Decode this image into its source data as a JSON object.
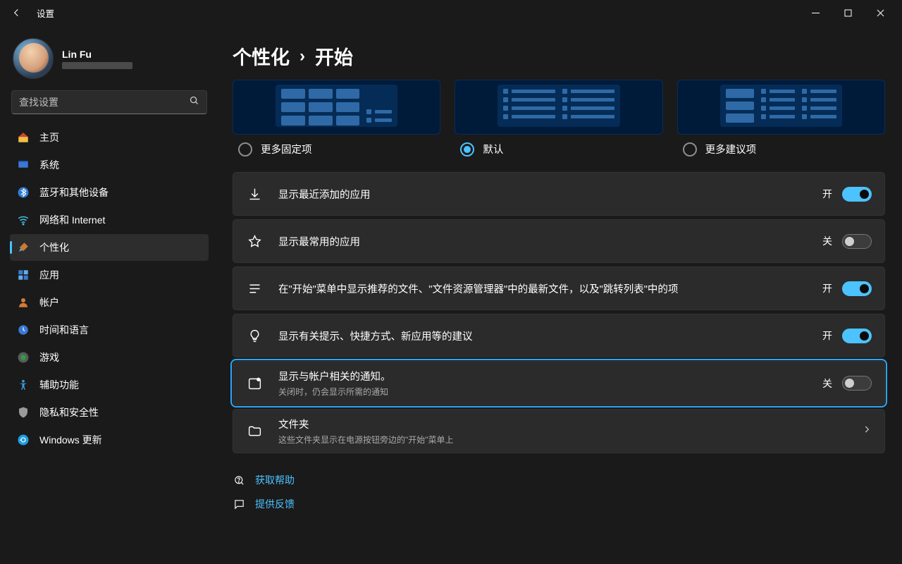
{
  "window": {
    "title": "设置"
  },
  "user": {
    "name": "Lin Fu",
    "email": ""
  },
  "search": {
    "placeholder": "查找设置"
  },
  "nav": {
    "home": "主页",
    "system": "系统",
    "bluetooth": "蓝牙和其他设备",
    "network": "网络和 Internet",
    "personalization": "个性化",
    "apps": "应用",
    "accounts": "帐户",
    "time": "时间和语言",
    "gaming": "游戏",
    "accessibility": "辅助功能",
    "privacy": "隐私和安全性",
    "update": "Windows 更新"
  },
  "breadcrumb": {
    "parent": "个性化",
    "current": "开始"
  },
  "layout_options": {
    "more_pins": "更多固定项",
    "default": "默认",
    "more_recs": "更多建议项"
  },
  "toggles": {
    "on": "开",
    "off": "关"
  },
  "settings": {
    "recently_added": {
      "title": "显示最近添加的应用",
      "state": "开",
      "on": true
    },
    "most_used": {
      "title": "显示最常用的应用",
      "state": "关",
      "on": false
    },
    "recommended": {
      "title": "在\"开始\"菜单中显示推荐的文件、\"文件资源管理器\"中的最新文件，以及\"跳转列表\"中的项",
      "state": "开",
      "on": true
    },
    "tips": {
      "title": "显示有关提示、快捷方式、新应用等的建议",
      "state": "开",
      "on": true
    },
    "account_notif": {
      "title": "显示与帐户相关的通知。",
      "sub": "关闭时，仍会显示所需的通知",
      "state": "关",
      "on": false
    },
    "folders": {
      "title": "文件夹",
      "sub": "这些文件夹显示在电源按钮旁边的\"开始\"菜单上"
    }
  },
  "footer": {
    "help": "获取帮助",
    "feedback": "提供反馈"
  }
}
